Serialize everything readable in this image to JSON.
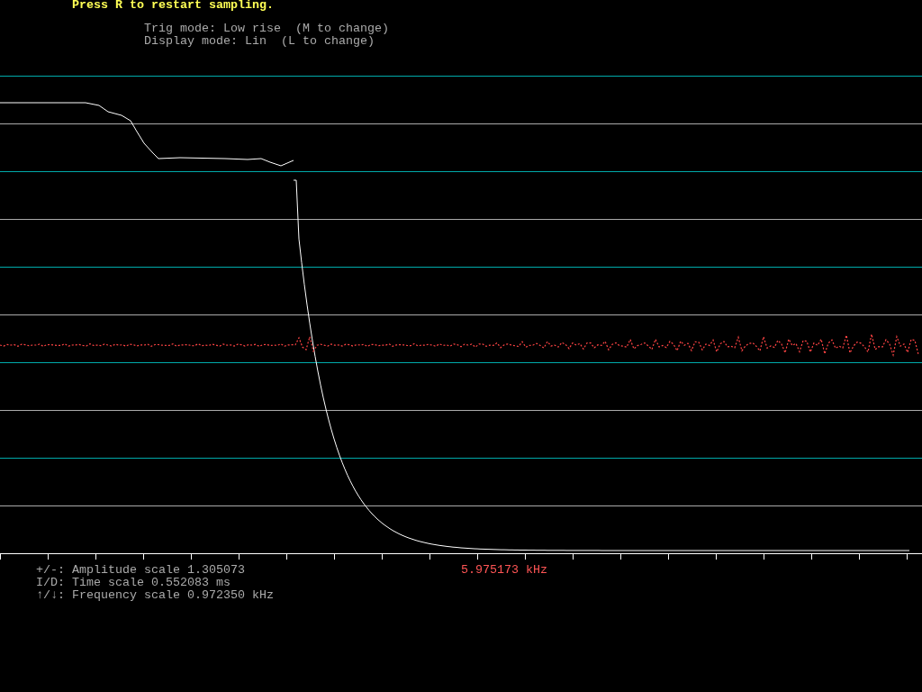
{
  "header": {
    "prompt": "Press R to restart sampling.",
    "trig_mode": "Trig mode: Low rise  (M to change)",
    "display_mode": "Display mode: Lin  (L to change)"
  },
  "footer": {
    "controls": [
      "+/-: Amplitude scale 1.305073",
      "I/D: Time scale 0.552083 ms",
      "↑/↓: Frequency scale 0.972350 kHz"
    ],
    "peak_frequency": "5.975173 kHz"
  }
}
